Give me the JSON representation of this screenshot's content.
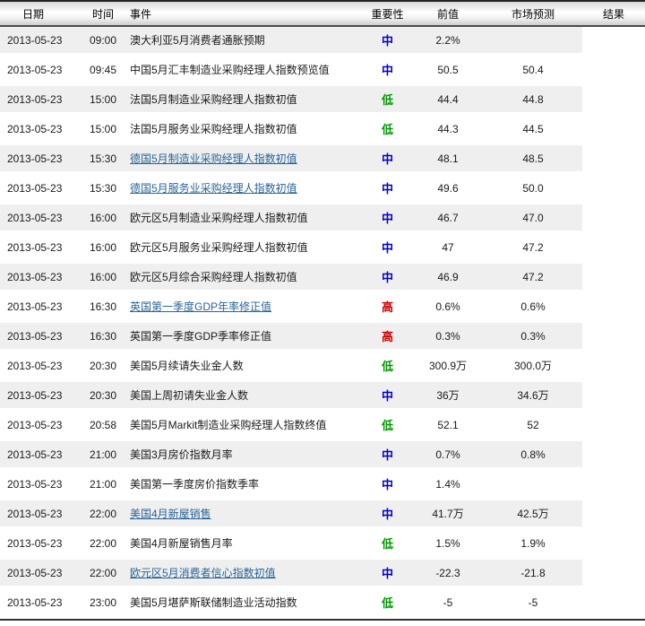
{
  "colors": {
    "importance_high": "#cc0000",
    "importance_medium": "#0000cc",
    "importance_low": "#009900",
    "link": "#2a6496",
    "stripe": "#efefef"
  },
  "table": {
    "columns": [
      {
        "label": "日期"
      },
      {
        "label": "时间"
      },
      {
        "label": "事件"
      },
      {
        "label": "重要性"
      },
      {
        "label": "前值"
      },
      {
        "label": "市场预测"
      },
      {
        "label": "结果"
      }
    ],
    "rows": [
      {
        "date": "2013-05-23",
        "time": "09:00",
        "event": "澳大利亚5月消费者通胀预期",
        "event_is_link": false,
        "importance": "中",
        "importance_level": "medium",
        "previous": "2.2%",
        "forecast": "",
        "result": ""
      },
      {
        "date": "2013-05-23",
        "time": "09:45",
        "event": "中国5月汇丰制造业采购经理人指数预览值",
        "event_is_link": false,
        "importance": "中",
        "importance_level": "medium",
        "previous": "50.5",
        "forecast": "50.4",
        "result": ""
      },
      {
        "date": "2013-05-23",
        "time": "15:00",
        "event": "法国5月制造业采购经理人指数初值",
        "event_is_link": false,
        "importance": "低",
        "importance_level": "low",
        "previous": "44.4",
        "forecast": "44.8",
        "result": ""
      },
      {
        "date": "2013-05-23",
        "time": "15:00",
        "event": "法国5月服务业采购经理人指数初值",
        "event_is_link": false,
        "importance": "低",
        "importance_level": "low",
        "previous": "44.3",
        "forecast": "44.5",
        "result": ""
      },
      {
        "date": "2013-05-23",
        "time": "15:30",
        "event": "德国5月制造业采购经理人指数初值",
        "event_is_link": true,
        "importance": "中",
        "importance_level": "medium",
        "previous": "48.1",
        "forecast": "48.5",
        "result": ""
      },
      {
        "date": "2013-05-23",
        "time": "15:30",
        "event": "德国5月服务业采购经理人指数初值",
        "event_is_link": true,
        "importance": "中",
        "importance_level": "medium",
        "previous": "49.6",
        "forecast": "50.0",
        "result": ""
      },
      {
        "date": "2013-05-23",
        "time": "16:00",
        "event": "欧元区5月制造业采购经理人指数初值",
        "event_is_link": false,
        "importance": "中",
        "importance_level": "medium",
        "previous": "46.7",
        "forecast": "47.0",
        "result": ""
      },
      {
        "date": "2013-05-23",
        "time": "16:00",
        "event": "欧元区5月服务业采购经理人指数初值",
        "event_is_link": false,
        "importance": "中",
        "importance_level": "medium",
        "previous": "47",
        "forecast": "47.2",
        "result": ""
      },
      {
        "date": "2013-05-23",
        "time": "16:00",
        "event": "欧元区5月综合采购经理人指数初值",
        "event_is_link": false,
        "importance": "中",
        "importance_level": "medium",
        "previous": "46.9",
        "forecast": "47.2",
        "result": ""
      },
      {
        "date": "2013-05-23",
        "time": "16:30",
        "event": "英国第一季度GDP年率修正值",
        "event_is_link": true,
        "importance": "高",
        "importance_level": "high",
        "previous": "0.6%",
        "forecast": "0.6%",
        "result": ""
      },
      {
        "date": "2013-05-23",
        "time": "16:30",
        "event": "英国第一季度GDP季率修正值",
        "event_is_link": false,
        "importance": "高",
        "importance_level": "high",
        "previous": "0.3%",
        "forecast": "0.3%",
        "result": ""
      },
      {
        "date": "2013-05-23",
        "time": "20:30",
        "event": "美国5月续请失业金人数",
        "event_is_link": false,
        "importance": "低",
        "importance_level": "low",
        "previous": "300.9万",
        "forecast": "300.0万",
        "result": ""
      },
      {
        "date": "2013-05-23",
        "time": "20:30",
        "event": "美国上周初请失业金人数",
        "event_is_link": false,
        "importance": "中",
        "importance_level": "medium",
        "previous": "36万",
        "forecast": "34.6万",
        "result": ""
      },
      {
        "date": "2013-05-23",
        "time": "20:58",
        "event": "美国5月Markit制造业采购经理人指数终值",
        "event_is_link": false,
        "importance": "低",
        "importance_level": "low",
        "previous": "52.1",
        "forecast": "52",
        "result": ""
      },
      {
        "date": "2013-05-23",
        "time": "21:00",
        "event": "美国3月房价指数月率",
        "event_is_link": false,
        "importance": "中",
        "importance_level": "medium",
        "previous": "0.7%",
        "forecast": "0.8%",
        "result": ""
      },
      {
        "date": "2013-05-23",
        "time": "21:00",
        "event": "美国第一季度房价指数季率",
        "event_is_link": false,
        "importance": "中",
        "importance_level": "medium",
        "previous": "1.4%",
        "forecast": "",
        "result": ""
      },
      {
        "date": "2013-05-23",
        "time": "22:00",
        "event": "美国4月新屋销售",
        "event_is_link": true,
        "importance": "中",
        "importance_level": "medium",
        "previous": "41.7万",
        "forecast": "42.5万",
        "result": ""
      },
      {
        "date": "2013-05-23",
        "time": "22:00",
        "event": "美国4月新屋销售月率",
        "event_is_link": false,
        "importance": "低",
        "importance_level": "low",
        "previous": "1.5%",
        "forecast": "1.9%",
        "result": ""
      },
      {
        "date": "2013-05-23",
        "time": "22:00",
        "event": "欧元区5月消费者信心指数初值",
        "event_is_link": true,
        "importance": "中",
        "importance_level": "medium",
        "previous": "-22.3",
        "forecast": "-21.8",
        "result": ""
      },
      {
        "date": "2013-05-23",
        "time": "23:00",
        "event": "美国5月堪萨斯联储制造业活动指数",
        "event_is_link": false,
        "importance": "低",
        "importance_level": "low",
        "previous": "-5",
        "forecast": "-5",
        "result": ""
      }
    ]
  }
}
